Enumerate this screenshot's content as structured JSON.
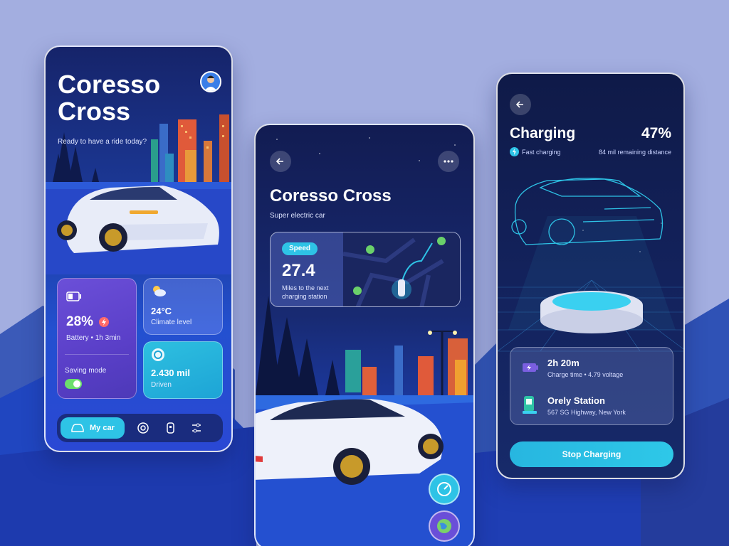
{
  "colors": {
    "accent": "#2ec3e6",
    "battery_card": "#5a3fc8",
    "background": "#a3aee0"
  },
  "home_screen": {
    "title": "Coresso Cross",
    "subtitle": "Ready to have a ride today?",
    "battery": {
      "value": "28%",
      "label": "Battery • 1h 3min",
      "icon": "battery-icon"
    },
    "saving_mode": {
      "label": "Saving mode",
      "enabled": true
    },
    "climate": {
      "value": "24°C",
      "label": "Climate level",
      "icon": "partly-cloudy-icon"
    },
    "driven": {
      "value": "2.430 mil",
      "label": "Driven",
      "icon": "speedometer-icon"
    },
    "nav": {
      "active_label": "My car",
      "items": [
        "car-icon",
        "tire-icon",
        "key-fob-icon",
        "sliders-icon"
      ]
    }
  },
  "detail_screen": {
    "title": "Coresso Cross",
    "subtitle": "Super electric car",
    "speed": {
      "pill": "Speed",
      "value": "27.4",
      "caption": "Miles to the next charging station"
    }
  },
  "charging_screen": {
    "title": "Charging",
    "percent": "47%",
    "mode": "Fast charging",
    "remaining": "84 mil remaining distance",
    "time": {
      "value": "2h 20m",
      "details": "Charge time • 4.79 voltage"
    },
    "station": {
      "name": "Orely Station",
      "address": "567 SG Highway, New York"
    },
    "action_label": "Stop Charging"
  }
}
